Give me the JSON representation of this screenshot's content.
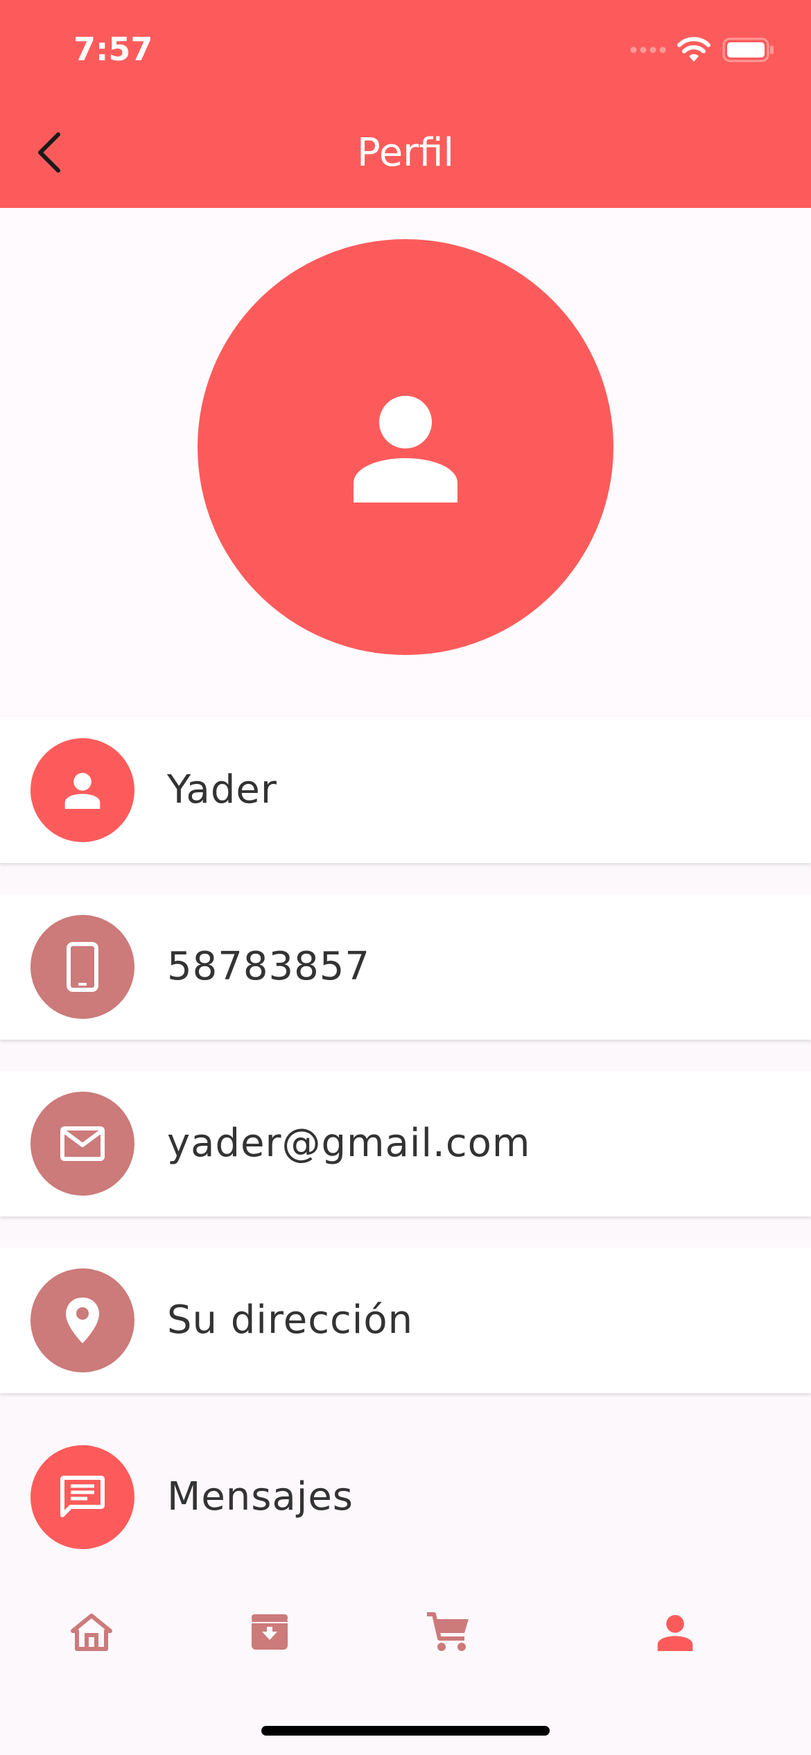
{
  "status_bar": {
    "time": "7:57"
  },
  "app_bar": {
    "title": "Perfil"
  },
  "profile": {
    "name": "Yader",
    "phone": "58783857",
    "email": "yader@gmail.com",
    "address": "Su dirección",
    "messages": "Mensajes"
  },
  "icons": {
    "back": "chevron-left-icon",
    "avatar": "person-icon",
    "name": "person-icon",
    "phone": "smartphone-icon",
    "email": "mail-icon",
    "address": "location-pin-icon",
    "messages": "message-icon",
    "nav_home": "home-icon",
    "nav_archive": "archive-icon",
    "nav_cart": "cart-icon",
    "nav_profile": "person-icon"
  },
  "colors": {
    "primary": "#fd5b5b",
    "muted": "#cc7a7a",
    "background": "#fdf8fb",
    "text": "#333333"
  },
  "bottom_nav": {
    "active": "profile"
  }
}
